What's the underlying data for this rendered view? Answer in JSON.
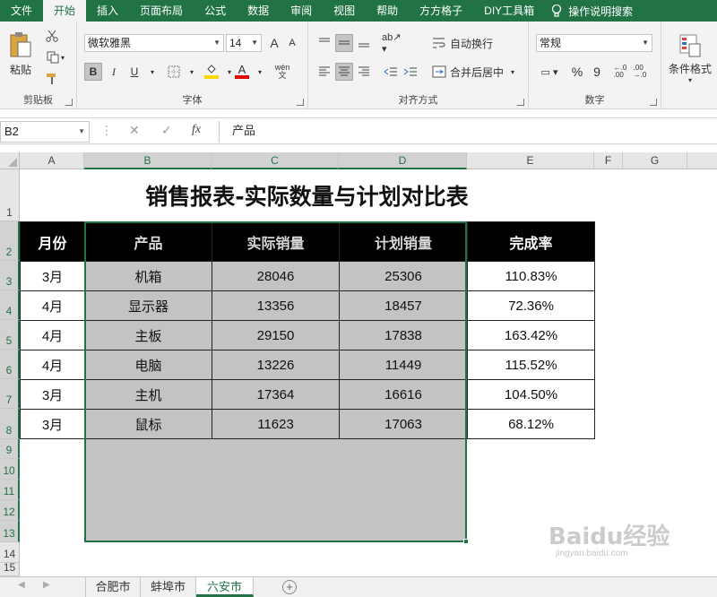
{
  "menu": {
    "tabs": [
      "文件",
      "开始",
      "插入",
      "页面布局",
      "公式",
      "数据",
      "审阅",
      "视图",
      "帮助",
      "方方格子",
      "DIY工具箱"
    ],
    "active": "开始",
    "help_search": "操作说明搜索"
  },
  "ribbon": {
    "clipboard": {
      "paste_label": "粘贴",
      "group_label": "剪贴板"
    },
    "font": {
      "font_name": "微软雅黑",
      "font_size": "14",
      "bold": "B",
      "italic": "I",
      "underline": "U",
      "grow": "A",
      "shrink": "A",
      "fill_color": "#ffd700",
      "font_color": "#e00000",
      "phonetic": "wén",
      "group_label": "字体"
    },
    "alignment": {
      "wrap_text": "自动换行",
      "merge_center": "合并后居中",
      "group_label": "对齐方式"
    },
    "number": {
      "format": "常规",
      "percent": "%",
      "comma": "9",
      "group_label": "数字"
    },
    "styles": {
      "conditional_format": "条件格式"
    }
  },
  "formula_bar": {
    "name_box": "B2",
    "fx": "fx",
    "formula": "产品"
  },
  "sheet": {
    "columns": [
      "A",
      "B",
      "C",
      "D",
      "E",
      "F",
      "G"
    ],
    "rows": [
      "1",
      "2",
      "3",
      "4",
      "5",
      "6",
      "7",
      "8",
      "9",
      "10",
      "11",
      "12",
      "13",
      "14",
      "15"
    ],
    "title": "销售报表-实际数量与计划对比表",
    "headers": [
      "月份",
      "产品",
      "实际销量",
      "计划销量",
      "完成率"
    ],
    "data": [
      [
        "3月",
        "机箱",
        "28046",
        "25306",
        "110.83%"
      ],
      [
        "4月",
        "显示器",
        "13356",
        "18457",
        "72.36%"
      ],
      [
        "4月",
        "主板",
        "29150",
        "17838",
        "163.42%"
      ],
      [
        "4月",
        "电脑",
        "13226",
        "11449",
        "115.52%"
      ],
      [
        "3月",
        "主机",
        "17364",
        "16616",
        "104.50%"
      ],
      [
        "3月",
        "鼠标",
        "11623",
        "17063",
        "68.12%"
      ]
    ]
  },
  "sheet_tabs": [
    "合肥市",
    "蚌埠市",
    "六安市"
  ],
  "active_sheet": "六安市",
  "watermark": {
    "text": "Baidu经验",
    "sub": "jingyan.baidu.com"
  }
}
